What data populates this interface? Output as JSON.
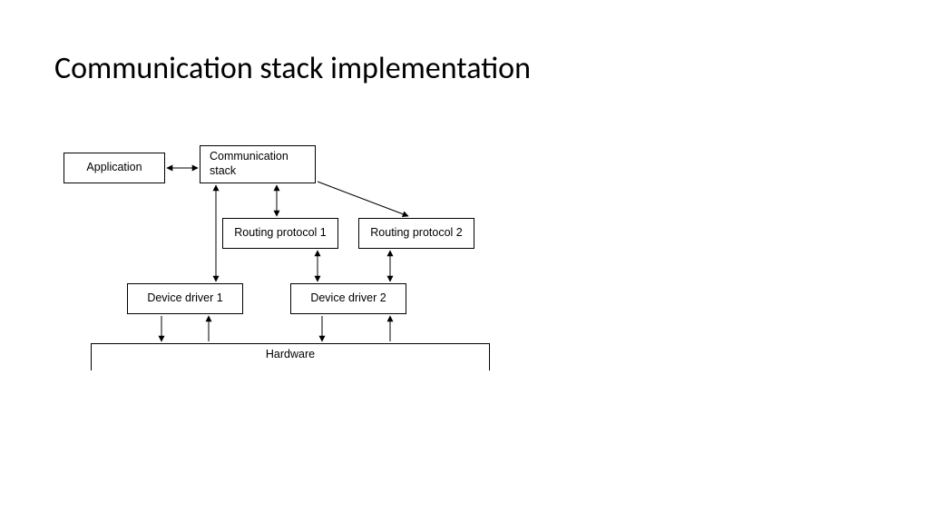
{
  "title": "Communication stack implementation",
  "nodes": {
    "application": "Application",
    "comm_stack": "Communication stack",
    "routing1": "Routing protocol 1",
    "routing2": "Routing protocol 2",
    "driver1": "Device driver 1",
    "driver2": "Device driver 2",
    "hardware": "Hardware"
  },
  "edges": [
    {
      "from": "application",
      "to": "comm_stack",
      "dir": "both"
    },
    {
      "from": "comm_stack",
      "to": "routing1",
      "dir": "both"
    },
    {
      "from": "comm_stack",
      "to": "routing2",
      "dir": "one"
    },
    {
      "from": "comm_stack",
      "to": "driver1",
      "dir": "both"
    },
    {
      "from": "routing1",
      "to": "driver2",
      "dir": "both"
    },
    {
      "from": "routing2",
      "to": "driver2",
      "dir": "both"
    },
    {
      "from": "driver1",
      "to": "hardware",
      "dir": "down"
    },
    {
      "from": "hardware",
      "to": "driver1",
      "dir": "up"
    },
    {
      "from": "driver2",
      "to": "hardware",
      "dir": "down"
    },
    {
      "from": "hardware",
      "to": "driver2",
      "dir": "up"
    }
  ]
}
